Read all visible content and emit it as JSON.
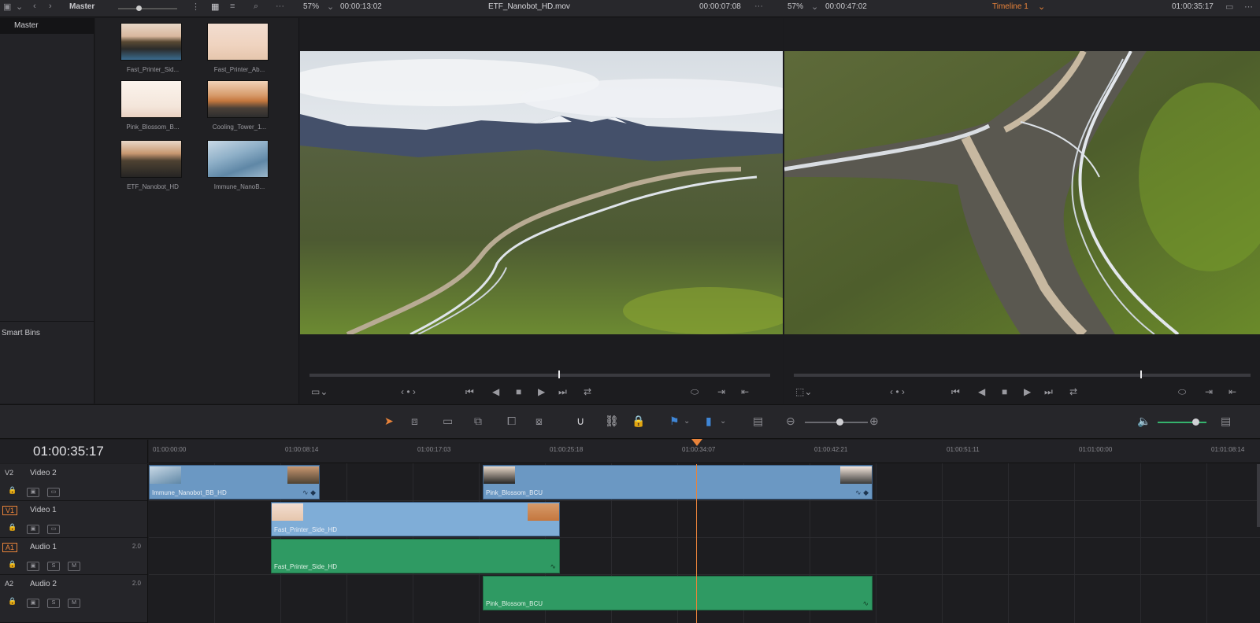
{
  "topbar": {
    "bin_title": "Master",
    "left_zoom": "57%",
    "left_tc_duration": "00:00:13:02",
    "left_clip_name": "ETF_Nanobot_HD.mov",
    "left_tc_position": "00:00:07:08",
    "right_zoom": "57%",
    "right_tc_duration": "00:00:47:02",
    "right_timeline_name": "Timeline 1",
    "right_tc_position": "01:00:35:17"
  },
  "bins": {
    "master": "Master",
    "smart_bins": "Smart Bins"
  },
  "media_pool": {
    "clips": [
      {
        "name": "Fast_Printer_Sid..."
      },
      {
        "name": "Fast_Printer_Ab..."
      },
      {
        "name": "Pink_Blossom_B..."
      },
      {
        "name": "Cooling_Tower_1..."
      },
      {
        "name": "ETF_Nanobot_HD"
      },
      {
        "name": "Immune_NanoB..."
      }
    ]
  },
  "timeline": {
    "timecode": "01:00:35:17",
    "ruler": [
      "01:00:00:00",
      "01:00:08:14",
      "01:00:17:03",
      "01:00:25:18",
      "01:00:34:07",
      "01:00:42:21",
      "01:00:51:11",
      "01:01:00:00",
      "01:01:08:14"
    ],
    "tracks": [
      {
        "id": "V2",
        "name": "Video 2",
        "level": ""
      },
      {
        "id": "V1",
        "name": "Video 1",
        "level": ""
      },
      {
        "id": "A1",
        "name": "Audio 1",
        "level": "2.0"
      },
      {
        "id": "A2",
        "name": "Audio 2",
        "level": "2.0"
      }
    ],
    "clips": {
      "v2a": "Immune_Nanobot_BB_HD",
      "v2b": "Pink_Blossom_BCU",
      "v1a": "Fast_Printer_Side_HD",
      "a1a": "Fast_Printer_Side_HD",
      "a2a": "Pink_Blossom_BCU"
    }
  },
  "colors": {
    "accent": "#e8833a",
    "video_clip": "#6b98c3",
    "audio_clip": "#2f9a63"
  }
}
